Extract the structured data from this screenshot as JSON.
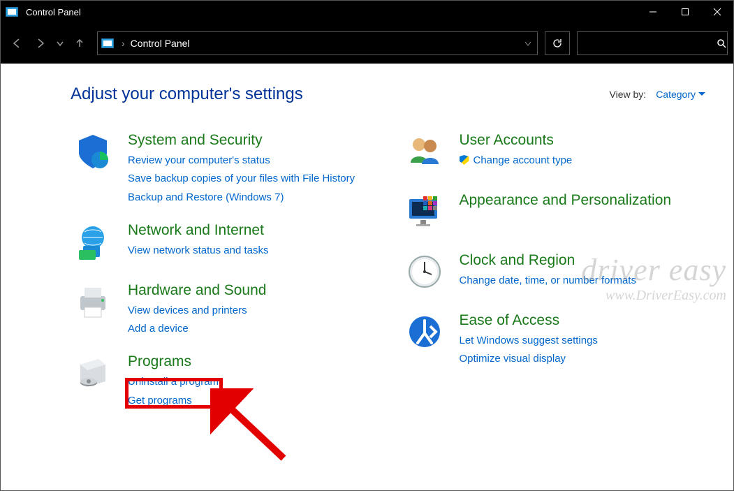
{
  "window": {
    "title": "Control Panel"
  },
  "address": {
    "crumb": "Control Panel"
  },
  "header": {
    "title": "Adjust your computer's settings",
    "viewby_label": "View by:",
    "viewby_value": "Category"
  },
  "left": [
    {
      "title": "System and Security",
      "links": [
        {
          "label": "Review your computer's status"
        },
        {
          "label": "Save backup copies of your files with File History"
        },
        {
          "label": "Backup and Restore (Windows 7)"
        }
      ]
    },
    {
      "title": "Network and Internet",
      "links": [
        {
          "label": "View network status and tasks"
        }
      ]
    },
    {
      "title": "Hardware and Sound",
      "links": [
        {
          "label": "View devices and printers"
        },
        {
          "label": "Add a device"
        }
      ]
    },
    {
      "title": "Programs",
      "links": [
        {
          "label": "Uninstall a program"
        },
        {
          "label": "Get programs"
        }
      ]
    }
  ],
  "right": [
    {
      "title": "User Accounts",
      "links": [
        {
          "label": "Change account type",
          "shield": true
        }
      ]
    },
    {
      "title": "Appearance and Personalization",
      "links": []
    },
    {
      "title": "Clock and Region",
      "links": [
        {
          "label": "Change date, time, or number formats"
        }
      ]
    },
    {
      "title": "Ease of Access",
      "links": [
        {
          "label": "Let Windows suggest settings"
        },
        {
          "label": "Optimize visual display"
        }
      ]
    }
  ],
  "watermark": {
    "line1": "driver easy",
    "line2": "www.DriverEasy.com"
  }
}
